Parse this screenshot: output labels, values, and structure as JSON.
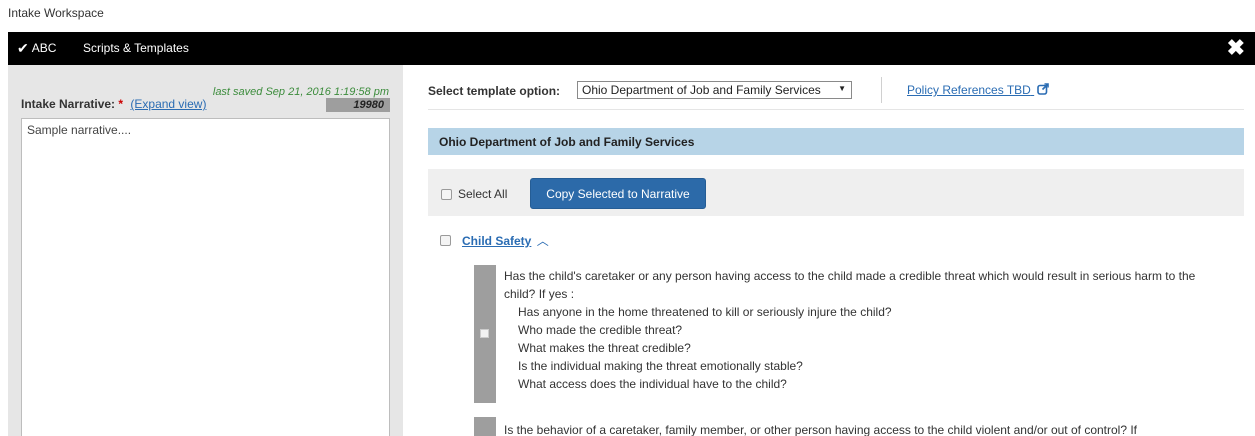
{
  "app": {
    "title": "Intake Workspace"
  },
  "topbar": {
    "tab_abc": "ABC",
    "tab_scripts": "Scripts & Templates",
    "check_icon": "check-icon",
    "close_icon": "close-icon"
  },
  "narrative": {
    "last_saved": "last saved Sep 21, 2016 1:19:58 pm",
    "label": "Intake Narrative:",
    "required_mark": "*",
    "expand_link": "(Expand view)",
    "char_count": "19980",
    "text": "Sample narrative...."
  },
  "template": {
    "label": "Select template option:",
    "selected": "Ohio Department of Job and Family Services",
    "policy_link": "Policy References TBD",
    "section_title": "Ohio Department of Job and Family Services",
    "select_all": "Select All",
    "copy_button": "Copy Selected to Narrative",
    "category": "Child Safety",
    "questions": [
      {
        "lead": "Has the child's caretaker or any person having access to the child made a credible threat which would result in serious harm to the child?  If yes :",
        "subs": [
          "Has anyone in the home threatened to kill or seriously injure the child?",
          "Who made the credible threat?",
          "What makes the threat credible?",
          "Is the individual making the threat emotionally stable?",
          "What access does the individual have to the child?"
        ]
      },
      {
        "lead": "Is the behavior of a caretaker, family member, or other person having access to the child violent and/or out of control?  If",
        "subs": []
      }
    ]
  },
  "colors": {
    "topbar_bg": "#000000",
    "left_panel_bg": "#e6e6e6",
    "section_header_bg": "#b7d4e7",
    "button_bg": "#2c6aa9",
    "link": "#2a6cb3",
    "saved_text": "#3c8c3c"
  }
}
